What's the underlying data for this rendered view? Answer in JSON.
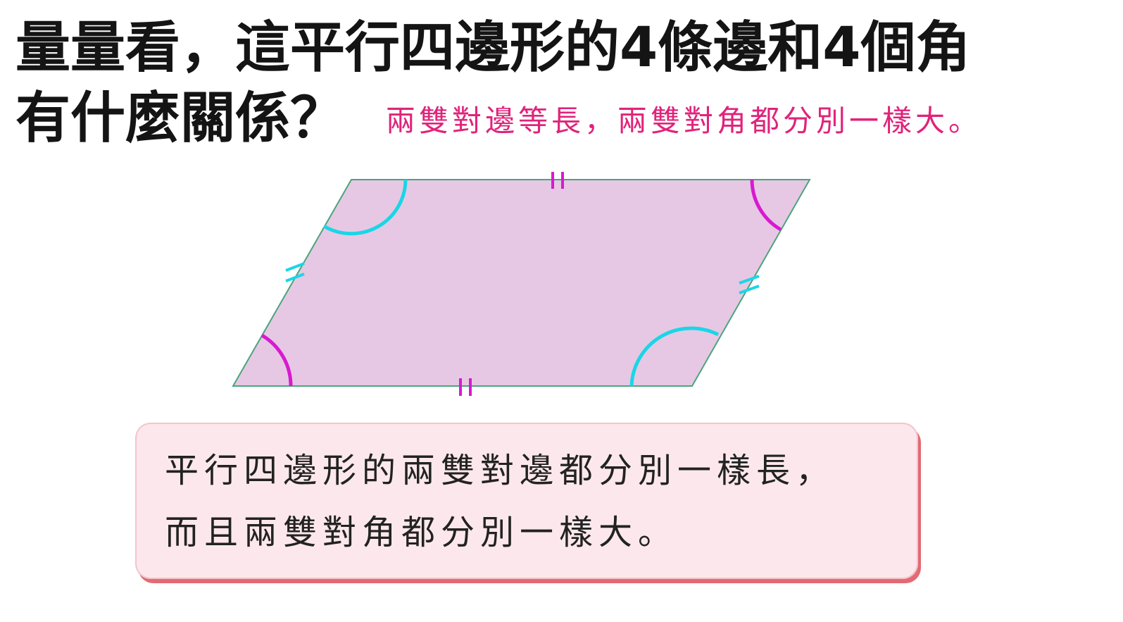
{
  "question": "量量看，這平行四邊形的4條邊和4個角\n有什麼關係？",
  "answer": "兩雙對邊等長，兩雙對角都分別一樣大。",
  "summary": {
    "line1": "平行四邊形的兩雙對邊都分別一樣長，",
    "line2": "而且兩雙對角都分別一樣大。"
  },
  "colors": {
    "fill": "#e6c8e4",
    "edge": "#4aa57a",
    "cyan_marks": "#1ad6e6",
    "magenta_marks": "#d81ad0",
    "answer_text": "#e0237a",
    "box_fill": "#fce8ec",
    "box_shadow": "#e36a74"
  }
}
